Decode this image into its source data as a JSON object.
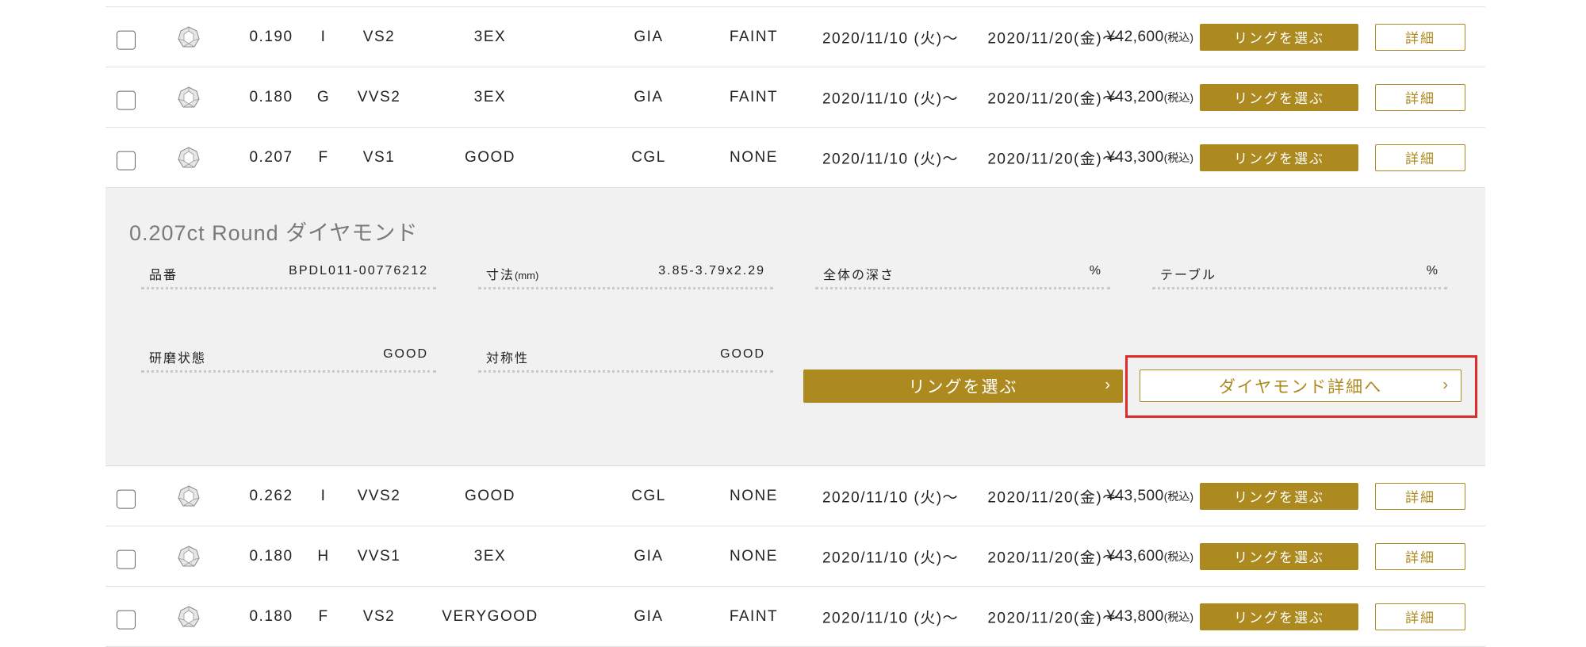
{
  "rows_top": [
    {
      "carat": "0.190",
      "color": "I",
      "clarity": "VS2",
      "cut": "3EX",
      "lab": "GIA",
      "fluor": "FAINT",
      "date1": "2020/11/10 (火)〜",
      "date2": "2020/11/20(金)〜",
      "price": "¥42,600",
      "tax": "(税込)",
      "select": "リングを選ぶ",
      "detail": "詳細"
    },
    {
      "carat": "0.180",
      "color": "G",
      "clarity": "VVS2",
      "cut": "3EX",
      "lab": "GIA",
      "fluor": "FAINT",
      "date1": "2020/11/10 (火)〜",
      "date2": "2020/11/20(金)〜",
      "price": "¥43,200",
      "tax": "(税込)",
      "select": "リングを選ぶ",
      "detail": "詳細"
    },
    {
      "carat": "0.207",
      "color": "F",
      "clarity": "VS1",
      "cut": "GOOD",
      "lab": "CGL",
      "fluor": "NONE",
      "date1": "2020/11/10 (火)〜",
      "date2": "2020/11/20(金)〜",
      "price": "¥43,300",
      "tax": "(税込)",
      "select": "リングを選ぶ",
      "detail": "詳細"
    }
  ],
  "expanded": {
    "title": "0.207ct Round ダイヤモンド",
    "specs": {
      "item_no": {
        "label": "品番",
        "value": "BPDL011-00776212"
      },
      "size": {
        "label": "寸法",
        "unit": "(mm)",
        "value": "3.85-3.79x2.29"
      },
      "depth": {
        "label": "全体の深さ",
        "value": "%"
      },
      "table": {
        "label": "テーブル",
        "value": "%"
      },
      "polish": {
        "label": "研磨状態",
        "value": "GOOD"
      },
      "symmetry": {
        "label": "対称性",
        "value": "GOOD"
      }
    },
    "select_ring": "リングを選ぶ",
    "diamond_detail": "ダイヤモンド詳細へ",
    "chevron": "›"
  },
  "rows_bottom": [
    {
      "carat": "0.262",
      "color": "I",
      "clarity": "VVS2",
      "cut": "GOOD",
      "lab": "CGL",
      "fluor": "NONE",
      "date1": "2020/11/10 (火)〜",
      "date2": "2020/11/20(金)〜",
      "price": "¥43,500",
      "tax": "(税込)",
      "select": "リングを選ぶ",
      "detail": "詳細"
    },
    {
      "carat": "0.180",
      "color": "H",
      "clarity": "VVS1",
      "cut": "3EX",
      "lab": "GIA",
      "fluor": "NONE",
      "date1": "2020/11/10 (火)〜",
      "date2": "2020/11/20(金)〜",
      "price": "¥43,600",
      "tax": "(税込)",
      "select": "リングを選ぶ",
      "detail": "詳細"
    },
    {
      "carat": "0.180",
      "color": "F",
      "clarity": "VS2",
      "cut": "VERYGOOD",
      "lab": "GIA",
      "fluor": "FAINT",
      "date1": "2020/11/10 (火)〜",
      "date2": "2020/11/20(金)〜",
      "price": "¥43,800",
      "tax": "(税込)",
      "select": "リングを選ぶ",
      "detail": "詳細"
    }
  ],
  "colors": {
    "gold": "#ac8a1f",
    "highlight": "#e02b2b",
    "panel": "#f2f1f1"
  },
  "icons": {
    "diamond": "diamond-icon",
    "checkbox": "checkbox"
  }
}
